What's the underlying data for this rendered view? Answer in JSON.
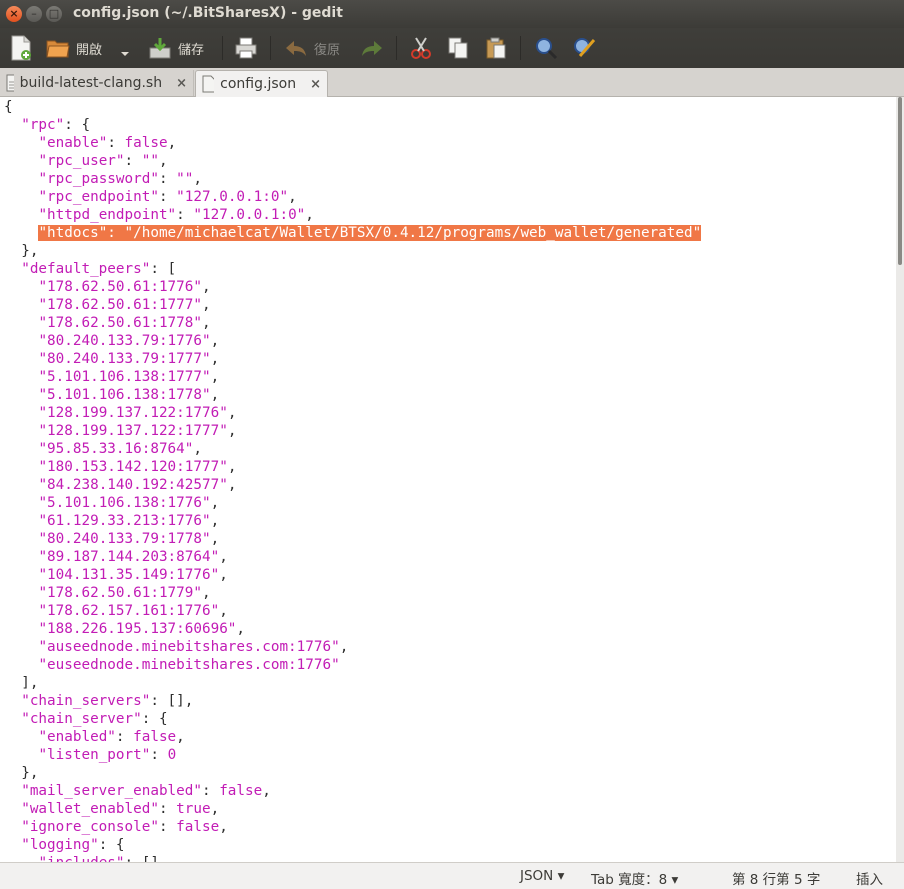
{
  "window": {
    "title": "config.json (~/.BitSharesX) - gedit",
    "close": "×",
    "minimize": "–",
    "maximize": "□"
  },
  "toolbar": {
    "open_label": "開啟",
    "save_label": "儲存",
    "undo_label": "復原"
  },
  "tabs": [
    {
      "label": "build-latest-clang.sh",
      "close": "×"
    },
    {
      "label": "config.json",
      "close": "×"
    }
  ],
  "editor": {
    "lines": [
      "{",
      "  \"rpc\": {",
      "    \"enable\": false,",
      "    \"rpc_user\": \"\",",
      "    \"rpc_password\": \"\",",
      "    \"rpc_endpoint\": \"127.0.0.1:0\",",
      "    \"httpd_endpoint\": \"127.0.0.1:0\",",
      "    \"htdocs\": \"/home/michaelcat/Wallet/BTSX/0.4.12/programs/web_wallet/generated\"",
      "  },",
      "  \"default_peers\": [",
      "    \"178.62.50.61:1776\",",
      "    \"178.62.50.61:1777\",",
      "    \"178.62.50.61:1778\",",
      "    \"80.240.133.79:1776\",",
      "    \"80.240.133.79:1777\",",
      "    \"5.101.106.138:1777\",",
      "    \"5.101.106.138:1778\",",
      "    \"128.199.137.122:1776\",",
      "    \"128.199.137.122:1777\",",
      "    \"95.85.33.16:8764\",",
      "    \"180.153.142.120:1777\",",
      "    \"84.238.140.192:42577\",",
      "    \"5.101.106.138:1776\",",
      "    \"61.129.33.213:1776\",",
      "    \"80.240.133.79:1778\",",
      "    \"89.187.144.203:8764\",",
      "    \"104.131.35.149:1776\",",
      "    \"178.62.50.61:1779\",",
      "    \"178.62.157.161:1776\",",
      "    \"188.226.195.137:60696\",",
      "    \"auseednode.minebitshares.com:1776\",",
      "    \"euseednode.minebitshares.com:1776\"",
      "  ],",
      "  \"chain_servers\": [],",
      "  \"chain_server\": {",
      "    \"enabled\": false,",
      "    \"listen_port\": 0",
      "  },",
      "  \"mail_server_enabled\": false,",
      "  \"wallet_enabled\": true,",
      "  \"ignore_console\": false,",
      "  \"logging\": {",
      "    \"includes\": [],"
    ],
    "selected_line_index": 7
  },
  "statusbar": {
    "language": "JSON",
    "tab_width": "Tab 寬度：8",
    "position": "第 8 行第 5 字",
    "mode": "插入"
  },
  "colors": {
    "syntax": "#c21cb5",
    "selection": "#f07746",
    "toolbar": "#3c3b37"
  }
}
